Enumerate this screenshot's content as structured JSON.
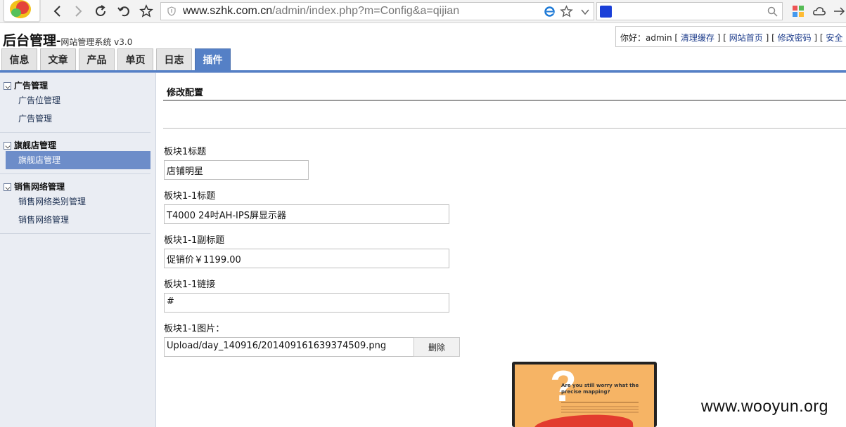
{
  "browser": {
    "url_host": "www.szhk.com.cn",
    "url_path": "/admin/index.php?m=Config&a=qijian",
    "search_value": ""
  },
  "header": {
    "title": "后台管理-",
    "subtitle": "网站管理系统 v3.0",
    "greeting": "你好：admin",
    "links": {
      "clear_cache": "清理缓存",
      "site_home": "网站首页",
      "change_password": "修改密码",
      "safe": "安全"
    },
    "brackets": {
      "b1": " [ ",
      "b2": " ] [ ",
      "b3": " ] [ ",
      "b4": " ] [ "
    }
  },
  "tabs": [
    {
      "label": "信息"
    },
    {
      "label": "文章"
    },
    {
      "label": "产品"
    },
    {
      "label": "单页"
    },
    {
      "label": "日志"
    },
    {
      "label": "插件",
      "active": true
    }
  ],
  "sidebar": {
    "groups": [
      {
        "title": "广告管理",
        "items": [
          "广告位管理",
          "广告管理"
        ]
      },
      {
        "title": "旗舰店管理",
        "items": [
          "旗舰店管理"
        ]
      },
      {
        "title": "销售网络管理",
        "items": [
          "销售网络类别管理",
          "销售网络管理"
        ]
      }
    ],
    "active_item": "旗舰店管理"
  },
  "main": {
    "section_title": "修改配置",
    "fields": [
      {
        "label": "板块1标题",
        "value": "店铺明星"
      },
      {
        "label": "板块1-1标题",
        "value": "T4000 24吋AH-IPS屏显示器"
      },
      {
        "label": "板块1-1副标题",
        "value": "促销价￥1199.00"
      },
      {
        "label": "板块1-1链接",
        "value": "#"
      },
      {
        "label": "板块1-1图片：",
        "value": "Upload/day_140916/201409161639374509.png"
      }
    ],
    "delete_button": "删除",
    "preview": {
      "text": "Are you still worry what the precise mapping?"
    }
  },
  "watermark": "www.wooyun.org",
  "colors": {
    "accent": "#5580c6",
    "sidebar_bg": "#eaedf3",
    "link": "#1d3c8b"
  }
}
